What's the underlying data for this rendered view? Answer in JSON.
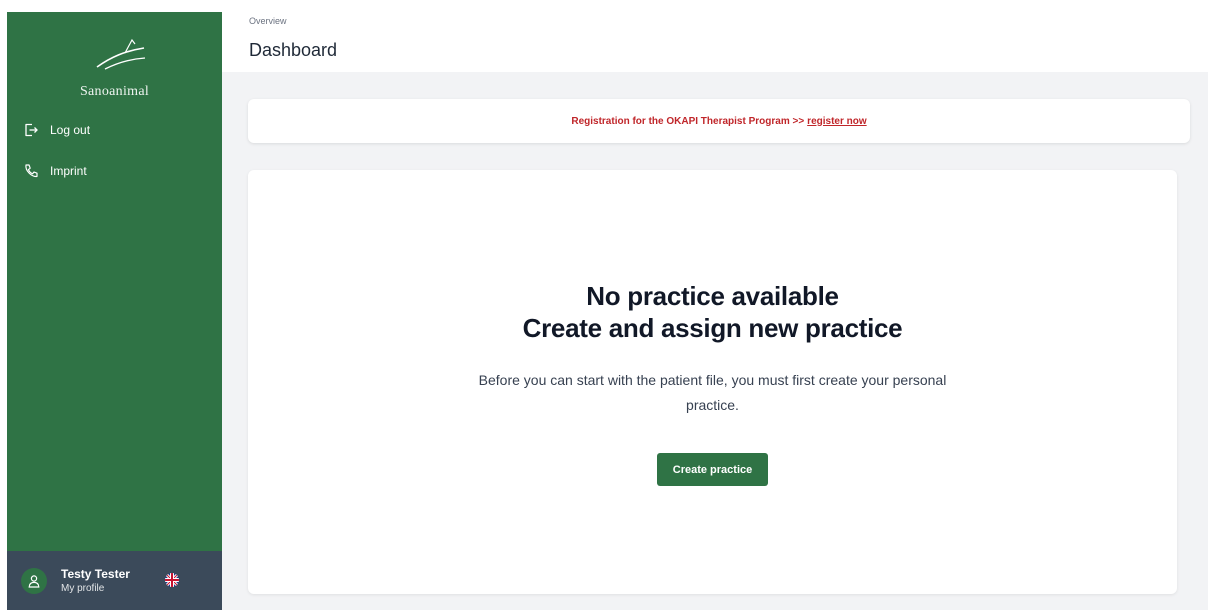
{
  "brand": {
    "name": "Sanoanimal"
  },
  "nav": [
    {
      "label": "Log out",
      "icon": "log-out-icon"
    },
    {
      "label": "Imprint",
      "icon": "phone-icon"
    }
  ],
  "profile": {
    "name": "Testy Tester",
    "subtitle": "My profile",
    "language_icon": "uk-flag-icon"
  },
  "header": {
    "breadcrumb": "Overview",
    "title": "Dashboard"
  },
  "banner": {
    "text": "Registration for the OKAPI Therapist Program >>",
    "link": "register now",
    "color": "#c0262a"
  },
  "empty_state": {
    "title_line1": "No practice available",
    "title_line2": "Create and assign new practice",
    "description": "Before you can start with the patient file, you must first create your personal practice.",
    "button": "Create practice"
  },
  "colors": {
    "sidebar": "#2f7345",
    "profile_bar": "#3b4a5a",
    "accent": "#2f7345",
    "background": "#f2f3f5"
  }
}
